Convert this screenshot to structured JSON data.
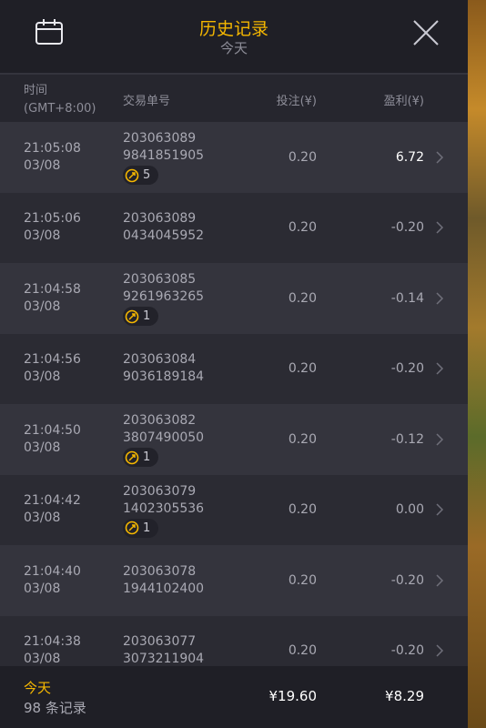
{
  "header": {
    "title": "历史记录",
    "subtitle": "今天",
    "left_icon": "calendar-icon",
    "right_icon": "close-icon"
  },
  "columns": {
    "time": "时间",
    "timezone": "(GMT+8:00)",
    "order": "交易单号",
    "bet": "投注(¥)",
    "profit": "盈利(¥)"
  },
  "rows": [
    {
      "time": "21:05:08",
      "date": "03/08",
      "order1": "203063089",
      "order2": "9841851905",
      "badge": "5",
      "bet": "0.20",
      "profit": "6.72",
      "positive": true
    },
    {
      "time": "21:05:06",
      "date": "03/08",
      "order1": "203063089",
      "order2": "0434045952",
      "badge": "",
      "bet": "0.20",
      "profit": "-0.20",
      "positive": false
    },
    {
      "time": "21:04:58",
      "date": "03/08",
      "order1": "203063085",
      "order2": "9261963265",
      "badge": "1",
      "bet": "0.20",
      "profit": "-0.14",
      "positive": false
    },
    {
      "time": "21:04:56",
      "date": "03/08",
      "order1": "203063084",
      "order2": "9036189184",
      "badge": "",
      "bet": "0.20",
      "profit": "-0.20",
      "positive": false
    },
    {
      "time": "21:04:50",
      "date": "03/08",
      "order1": "203063082",
      "order2": "3807490050",
      "badge": "1",
      "bet": "0.20",
      "profit": "-0.12",
      "positive": false
    },
    {
      "time": "21:04:42",
      "date": "03/08",
      "order1": "203063079",
      "order2": "1402305536",
      "badge": "1",
      "bet": "0.20",
      "profit": "0.00",
      "positive": false
    },
    {
      "time": "21:04:40",
      "date": "03/08",
      "order1": "203063078",
      "order2": "1944102400",
      "badge": "",
      "bet": "0.20",
      "profit": "-0.20",
      "positive": false
    },
    {
      "time": "21:04:38",
      "date": "03/08",
      "order1": "203063077",
      "order2": "3073211904",
      "badge": "",
      "bet": "0.20",
      "profit": "-0.20",
      "positive": false
    }
  ],
  "footer": {
    "label": "今天",
    "count": "98 条记录",
    "total_bet": "¥19.60",
    "total_profit": "¥8.29"
  },
  "colors": {
    "accent": "#f5b700",
    "header_bg": "#1f1f26",
    "row_odd": "#34343d",
    "row_even": "#2b2b33"
  }
}
